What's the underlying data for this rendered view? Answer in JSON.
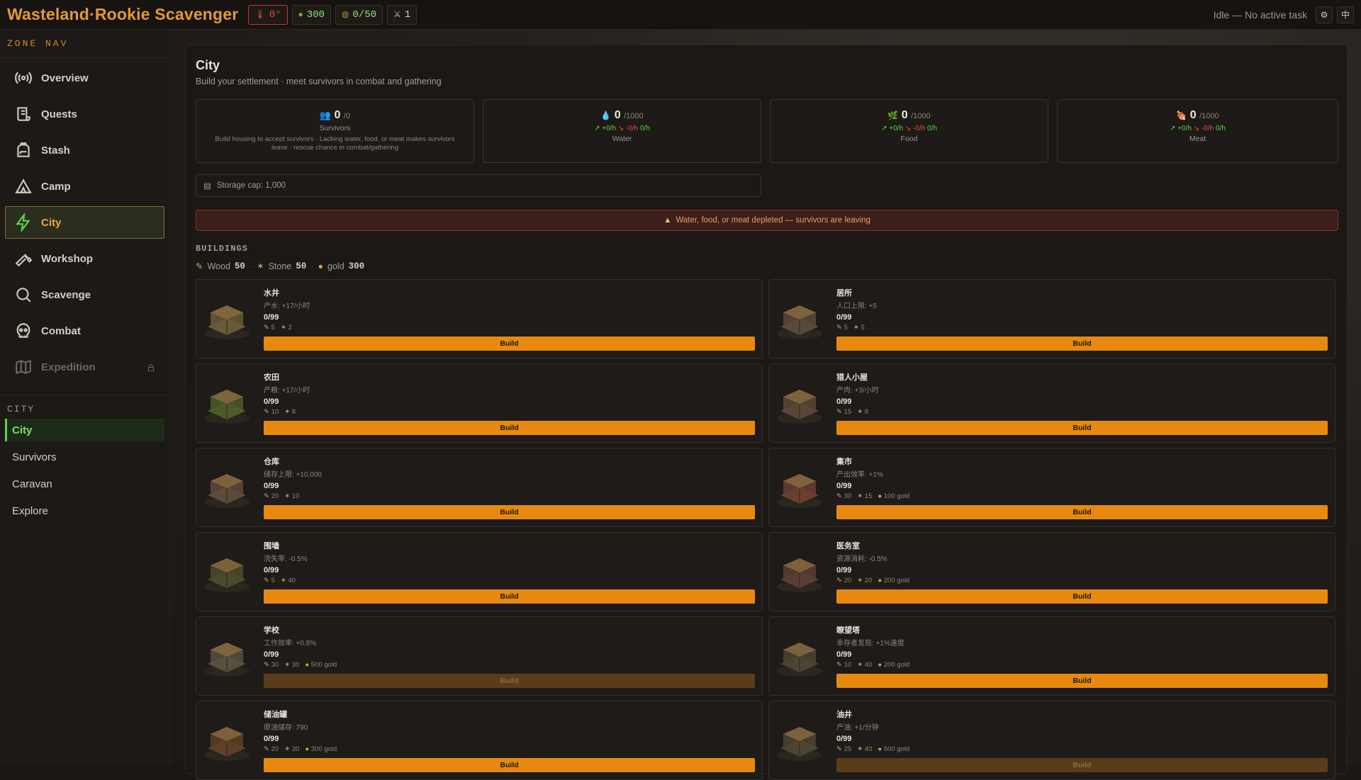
{
  "header": {
    "title": "Wasteland·Rookie Scavenger",
    "temperature": "0°",
    "gold": "300",
    "capacity": "0/50",
    "level": "1",
    "status": "Idle — No active task",
    "lang_label": "中"
  },
  "sidebar": {
    "zone_nav_label": "ZONE NAV",
    "items": [
      {
        "label": "Overview",
        "icon": "radio-signal-icon"
      },
      {
        "label": "Quests",
        "icon": "scroll-icon"
      },
      {
        "label": "Stash",
        "icon": "backpack-icon"
      },
      {
        "label": "Camp",
        "icon": "tent-icon"
      },
      {
        "label": "City",
        "icon": "bolt-icon"
      },
      {
        "label": "Workshop",
        "icon": "wrench-icon"
      },
      {
        "label": "Scavenge",
        "icon": "search-icon"
      },
      {
        "label": "Combat",
        "icon": "skull-icon"
      },
      {
        "label": "Expedition",
        "icon": "map-icon"
      }
    ],
    "city_section_label": "CITY",
    "city_items": [
      "City",
      "Survivors",
      "Caravan",
      "Explore"
    ]
  },
  "page": {
    "title": "City",
    "subtitle": "Build your settlement · meet survivors in combat and gathering"
  },
  "cards": {
    "survivors": {
      "value": "0",
      "cap": "/0",
      "label": "Survivors",
      "hint": "Build housing to accept survivors · Lacking water, food, or meat makes survivors leave · rescue chance in combat/gathering"
    },
    "water": {
      "value": "0",
      "cap": "/1000",
      "gain": "+0/h",
      "loss": "-0/h",
      "net": "0/h",
      "label": "Water"
    },
    "food": {
      "value": "0",
      "cap": "/1000",
      "gain": "+0/h",
      "loss": "-0/h",
      "net": "0/h",
      "label": "Food"
    },
    "meat": {
      "value": "0",
      "cap": "/1000",
      "gain": "+0/h",
      "loss": "-0/h",
      "net": "0/h",
      "label": "Meat"
    }
  },
  "storage_label": "Storage cap: 1,000",
  "alert_text": "Water, food, or meat depleted — survivors are leaving",
  "buildings_title": "BUILDINGS",
  "resources": {
    "wood_label": "Wood",
    "wood": "50",
    "stone_label": "Stone",
    "stone": "50",
    "gold_label": "gold",
    "gold": "300"
  },
  "build_label": "Build",
  "buildings": [
    {
      "name": "水井",
      "effect": "产水: +17/小时",
      "count": "0/99",
      "wood": "5",
      "stone": "2",
      "gold": "",
      "enabled": true
    },
    {
      "name": "居所",
      "effect": "人口上限: +5",
      "count": "0/99",
      "wood": "5",
      "stone": "5",
      "gold": "",
      "enabled": true
    },
    {
      "name": "农田",
      "effect": "产粮: +17/小时",
      "count": "0/99",
      "wood": "10",
      "stone": "8",
      "gold": "",
      "enabled": true
    },
    {
      "name": "猎人小屋",
      "effect": "产肉: +3/小时",
      "count": "0/99",
      "wood": "15",
      "stone": "8",
      "gold": "",
      "enabled": true
    },
    {
      "name": "仓库",
      "effect": "储存上限: +10,000",
      "count": "0/99",
      "wood": "20",
      "stone": "10",
      "gold": "",
      "enabled": true
    },
    {
      "name": "集市",
      "effect": "产出效率: +1%",
      "count": "0/99",
      "wood": "30",
      "stone": "15",
      "gold": "100 gold",
      "enabled": true
    },
    {
      "name": "围墙",
      "effect": "流失率: -0.5%",
      "count": "0/99",
      "wood": "5",
      "stone": "40",
      "gold": "",
      "enabled": true
    },
    {
      "name": "医务室",
      "effect": "资源消耗: -0.5%",
      "count": "0/99",
      "wood": "20",
      "stone": "20",
      "gold": "200 gold",
      "enabled": true
    },
    {
      "name": "学校",
      "effect": "工作效率: +0.8%",
      "count": "0/99",
      "wood": "30",
      "stone": "30",
      "gold": "500 gold",
      "enabled": false
    },
    {
      "name": "瞭望塔",
      "effect": "幸存者发现: +1%速度",
      "count": "0/99",
      "wood": "10",
      "stone": "40",
      "gold": "200 gold",
      "enabled": true
    },
    {
      "name": "储油罐",
      "effect": "原油储存: 790",
      "count": "0/99",
      "wood": "20",
      "stone": "30",
      "gold": "300 gold",
      "enabled": true
    },
    {
      "name": "油井",
      "effect": "产油: +1/分钟",
      "count": "0/99",
      "wood": "25",
      "stone": "40",
      "gold": "500 gold",
      "enabled": false
    }
  ],
  "colors": {
    "accent": "#e8890f",
    "green": "#5fd14a",
    "red": "#e74c3c"
  }
}
